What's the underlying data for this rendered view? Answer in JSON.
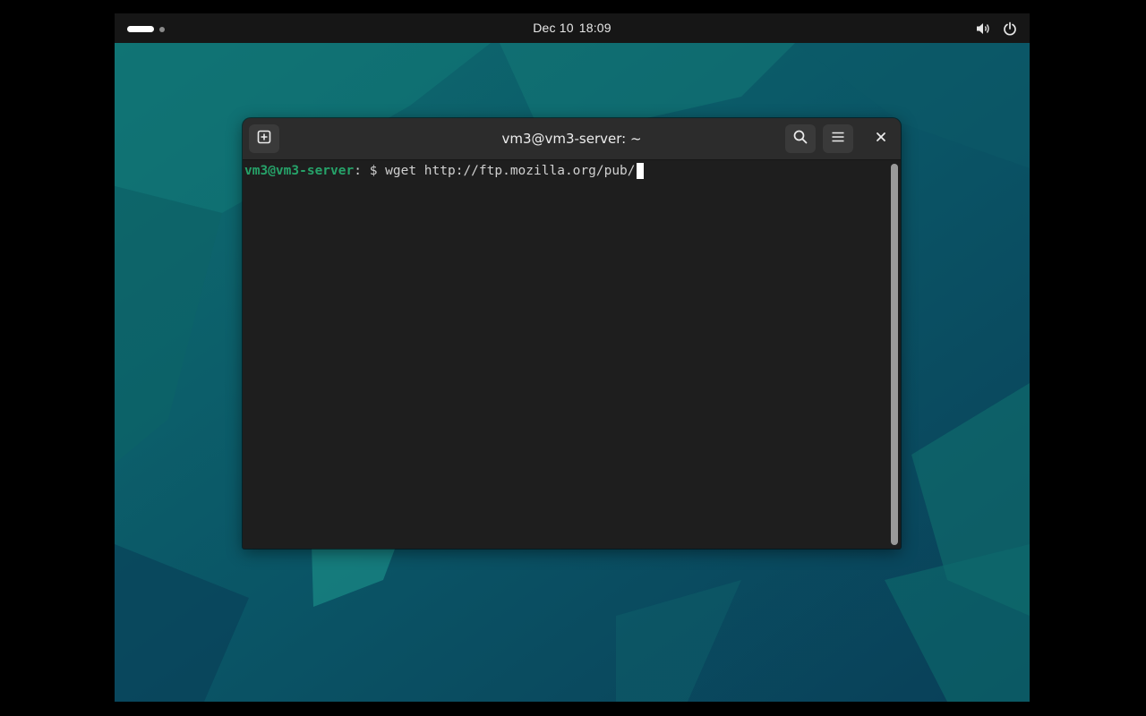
{
  "topbar": {
    "date": "Dec 10",
    "time": "18:09",
    "icons": [
      "workspace-indicator",
      "volume-icon",
      "power-icon"
    ]
  },
  "terminal": {
    "title": "vm3@vm3-server: ~",
    "buttons": [
      "new-tab-icon",
      "search-icon",
      "menu-icon",
      "close-icon"
    ],
    "prompt_user_host": "vm3@vm3-server",
    "prompt_path": ": ",
    "prompt_symbol": "$ ",
    "command": "wget http://ftp.mozilla.org/pub/"
  },
  "colors": {
    "desktop_bg": "#0b4e5e",
    "topbar_bg": "#161616",
    "terminal_bg": "#1e1e1e",
    "headerbar_bg": "#2c2c2c",
    "prompt_green": "#26a269"
  }
}
